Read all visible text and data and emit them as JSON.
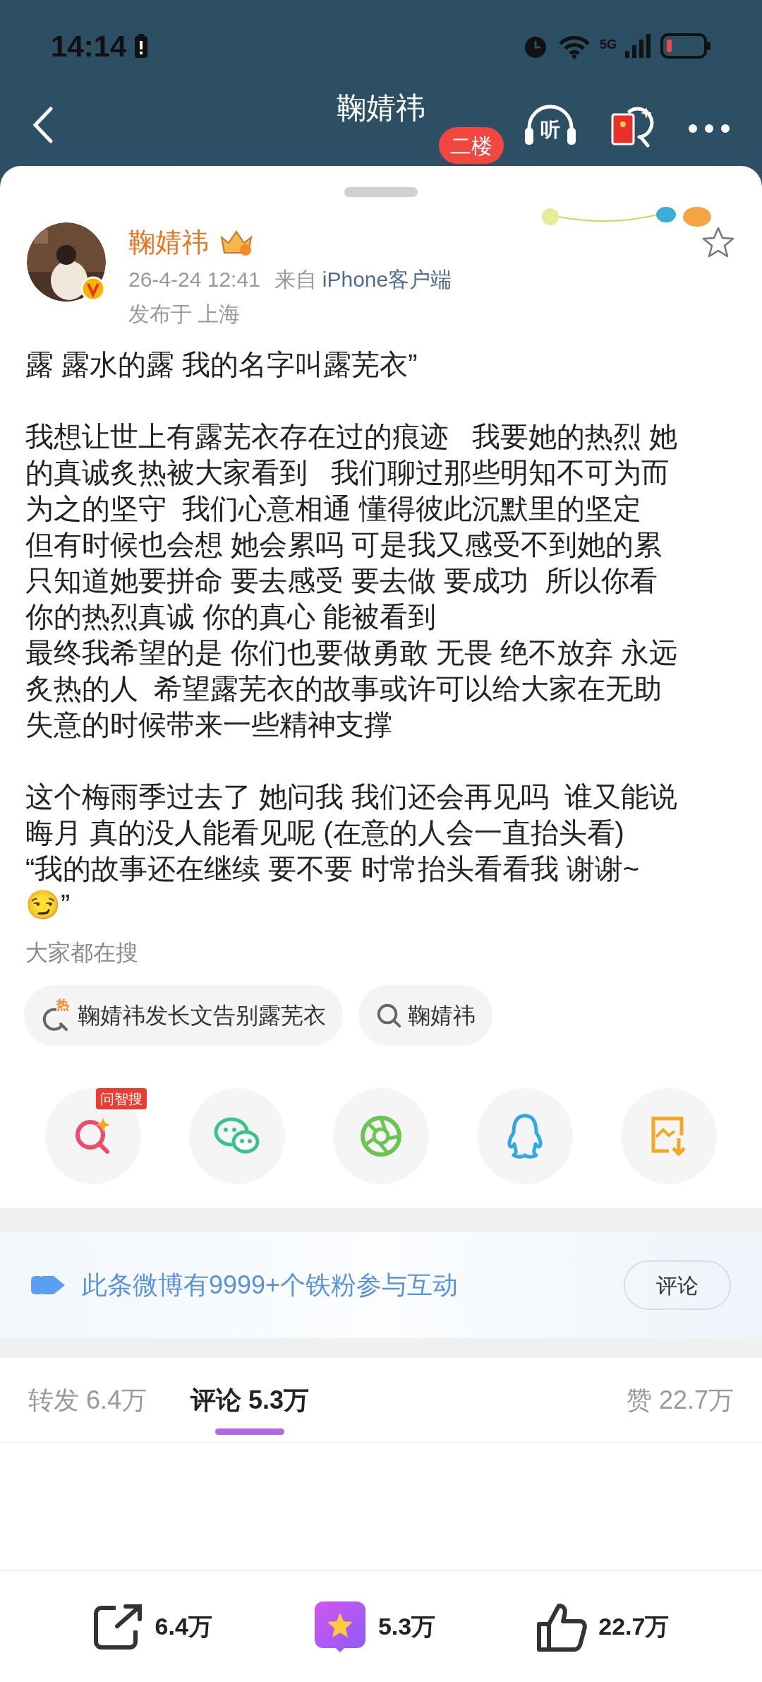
{
  "status_bar": {
    "time": "14:14",
    "network": "5G"
  },
  "nav": {
    "title": "鞠婧祎",
    "badge": "二楼",
    "listen_label": "听"
  },
  "post": {
    "author": "鞠婧祎",
    "time": "26-4-24 12:41",
    "source_prefix": "来自",
    "source": "iPhone客户端",
    "location": "发布于 上海",
    "paragraphs": [
      [
        "露 露水的露 我的名字叫露芜衣”"
      ],
      [
        "我想让世上有露芜衣存在过的痕迹   我要她的热烈 她",
        "的真诚炙热被大家看到   我们聊过那些明知不可为而",
        "为之的坚守  我们心意相通 懂得彼此沉默里的坚定",
        "但有时候也会想 她会累吗 可是我又感受不到她的累",
        "只知道她要拼命 要去感受 要去做 要成功  所以你看",
        "你的热烈真诚 你的真心 能被看到",
        "最终我希望的是 你们也要做勇敢 无畏 绝不放弃 永远",
        "炙热的人  希望露芜衣的故事或许可以给大家在无助",
        "失意的时候带来一些精神支撑"
      ],
      [
        "这个梅雨季过去了 她问我 我们还会再见吗  谁又能说",
        "晦月 真的没人能看见呢 (在意的人会一直抬头看)",
        "“我的故事还在继续 要不要 时常抬头看看我 谢谢~",
        "😏”"
      ]
    ]
  },
  "trending": {
    "heading": "大家都在搜",
    "chips": [
      {
        "kind": "hot",
        "icon_text": "热",
        "text": "鞠婧祎发长文告别露芜衣"
      },
      {
        "kind": "plain",
        "text": "鞠婧祎"
      }
    ]
  },
  "share": [
    {
      "kind": "ai_search",
      "badge": "问智搜"
    },
    {
      "kind": "wechat"
    },
    {
      "kind": "moments"
    },
    {
      "kind": "qq"
    },
    {
      "kind": "save_image"
    }
  ],
  "banner": {
    "text": "此条微博有9999+个铁粉参与互动",
    "button": "评论"
  },
  "tabs": [
    {
      "label": "转发 6.4万",
      "selected": false
    },
    {
      "label": "评论 5.3万",
      "selected": true
    },
    {
      "label": "赞 22.7万",
      "selected": false
    }
  ],
  "action_bar": [
    {
      "kind": "repost",
      "count": "6.4万"
    },
    {
      "kind": "comment",
      "count": "5.3万"
    },
    {
      "kind": "like",
      "count": "22.7万"
    }
  ]
}
